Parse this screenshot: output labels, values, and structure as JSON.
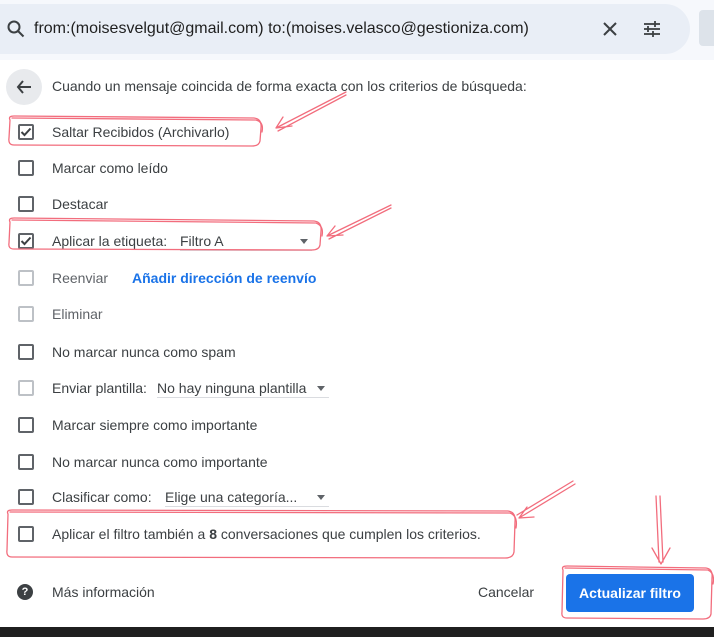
{
  "search": {
    "query": "from:(moisesvelgut@gmail.com) to:(moises.velasco@gestioniza.com)"
  },
  "filter": {
    "heading": "Cuando un mensaje coincida de forma exacta con los criterios de búsqueda:",
    "options": [
      {
        "label": "Saltar Recibidos (Archivarlo)",
        "checked": true,
        "disabled": false
      },
      {
        "label": "Marcar como leído",
        "checked": false,
        "disabled": false
      },
      {
        "label": "Destacar",
        "checked": false,
        "disabled": false
      },
      {
        "label": "Aplicar la etiqueta:",
        "checked": true,
        "disabled": false,
        "select_value": "Filtro A"
      },
      {
        "label": "Reenviar",
        "checked": false,
        "disabled": true,
        "link": "Añadir dirección de reenvío"
      },
      {
        "label": "Eliminar",
        "checked": false,
        "disabled": true
      },
      {
        "label": "No marcar nunca como spam",
        "checked": false,
        "disabled": false
      },
      {
        "label": "Enviar plantilla:",
        "checked": false,
        "disabled": true,
        "select_value": "No hay ninguna plantilla"
      },
      {
        "label": "Marcar siempre como importante",
        "checked": false,
        "disabled": false
      },
      {
        "label": "No marcar nunca como importante",
        "checked": false,
        "disabled": false
      },
      {
        "label": "Clasificar como:",
        "checked": false,
        "disabled": false,
        "select_value": "Elige una categoría..."
      }
    ],
    "apply_also": {
      "prefix": "Aplicar el filtro también a ",
      "count": "8",
      "suffix": " conversaciones que cumplen los criterios.",
      "checked": false
    }
  },
  "footer": {
    "more_info": "Más información",
    "cancel": "Cancelar",
    "update": "Actualizar filtro"
  },
  "colors": {
    "accent": "#1a73e8",
    "annotation": "#f26d7d"
  }
}
